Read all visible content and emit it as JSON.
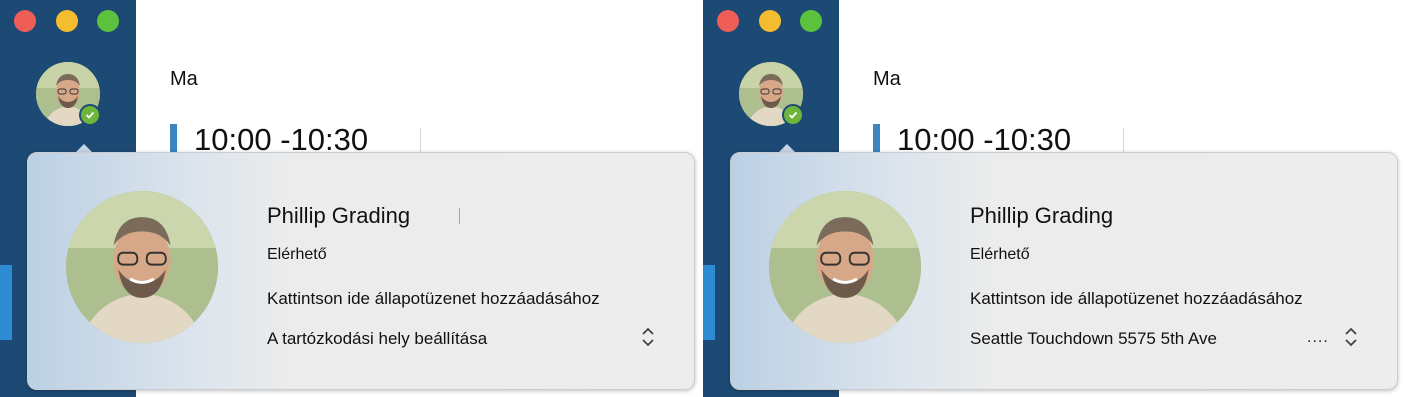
{
  "panels": [
    {
      "today_label": "Ma",
      "event_time": "10:00 -10:30",
      "card": {
        "name": "Phillip Grading",
        "status": "Elérhető",
        "status_message": "Kattintson ide állapotüzenet hozzáadásához",
        "location": "A tartózkodási hely beállítása",
        "location_more": ""
      }
    },
    {
      "today_label": "Ma",
      "event_time": "10:00 -10:30",
      "card": {
        "name": "Phillip Grading",
        "status": "Elérhető",
        "status_message": "Kattintson ide állapotüzenet hozzáadásához",
        "location": "Seattle Touchdown 5575 5th Ave",
        "location_more": "...."
      }
    }
  ],
  "colors": {
    "sidebar": "#1d4a74",
    "presence_available": "#6fb53b",
    "event_accent": "#3a86c2"
  },
  "icons": {
    "traffic_lights": [
      "close-icon",
      "minimize-icon",
      "zoom-icon"
    ],
    "presence": "checkmark-icon",
    "location_picker": "chevron-up-down-icon"
  }
}
